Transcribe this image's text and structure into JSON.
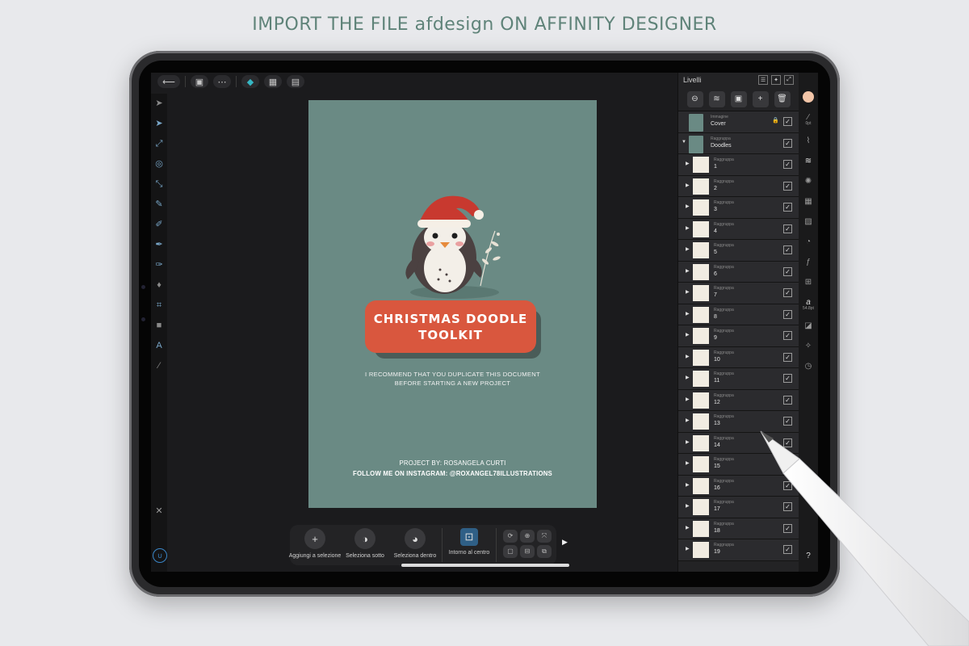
{
  "headline": "IMPORT THE FILE afdesign ON AFFINITY DESIGNER",
  "topbar": {
    "back": "⟵",
    "save": "▣",
    "more": "⋯",
    "persona_designer": "◆",
    "persona_pixel": "▦",
    "persona_export": "▤"
  },
  "artboard": {
    "banner_line1": "CHRISTMAS DOODLE",
    "banner_line2": "TOOLKIT",
    "note_line1": "I RECOMMEND THAT YOU DUPLICATE THIS DOCUMENT",
    "note_line2": "BEFORE STARTING A NEW PROJECT",
    "credit_project": "PROJECT BY: ROSANGELA CURTI",
    "credit_follow": "FOLLOW ME ON INSTAGRAM: @ROXANGEL78ILLUSTRATIONS",
    "background_color": "#6a8a84",
    "banner_color": "#d9573e"
  },
  "context_bar": {
    "items": [
      {
        "icon": "+",
        "label": "Aggiungi a selezione"
      },
      {
        "icon": "◑",
        "label": "Seleziona sotto"
      },
      {
        "icon": "◕",
        "label": "Seleziona dentro"
      },
      {
        "icon": "⊡",
        "label": "Intorno al centro"
      }
    ],
    "arrow": "▶"
  },
  "layers_panel": {
    "title": "Livelli",
    "top_rows": [
      {
        "kind": "Immagine",
        "name": "Cover",
        "locked": true
      },
      {
        "kind": "Raggruppa",
        "name": "Doodles",
        "locked": false
      }
    ],
    "groups": [
      {
        "kind": "Raggruppa",
        "name": "1"
      },
      {
        "kind": "Raggruppa",
        "name": "2"
      },
      {
        "kind": "Raggruppa",
        "name": "3"
      },
      {
        "kind": "Raggruppa",
        "name": "4"
      },
      {
        "kind": "Raggruppa",
        "name": "5"
      },
      {
        "kind": "Raggruppa",
        "name": "6"
      },
      {
        "kind": "Raggruppa",
        "name": "7"
      },
      {
        "kind": "Raggruppa",
        "name": "8"
      },
      {
        "kind": "Raggruppa",
        "name": "9"
      },
      {
        "kind": "Raggruppa",
        "name": "10"
      },
      {
        "kind": "Raggruppa",
        "name": "11"
      },
      {
        "kind": "Raggruppa",
        "name": "12"
      },
      {
        "kind": "Raggruppa",
        "name": "13"
      },
      {
        "kind": "Raggruppa",
        "name": "14"
      },
      {
        "kind": "Raggruppa",
        "name": "15"
      },
      {
        "kind": "Raggruppa",
        "name": "16"
      },
      {
        "kind": "Raggruppa",
        "name": "17"
      },
      {
        "kind": "Raggruppa",
        "name": "18"
      },
      {
        "kind": "Raggruppa",
        "name": "19"
      }
    ]
  },
  "right_strip": {
    "brush_size": "0pt",
    "font_size": "54.8pt",
    "help": "?"
  },
  "colors": {
    "accent": "#36b7c4",
    "swatch": "#f2c5a8",
    "headline": "#5f8379"
  }
}
